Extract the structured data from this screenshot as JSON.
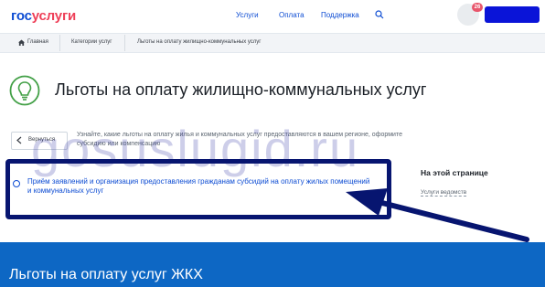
{
  "header": {
    "logo_gos": "гос",
    "logo_uslugi": "услуги",
    "nav": [
      "Услуги",
      "Оплата",
      "Поддержка"
    ],
    "search_icon": "search-icon",
    "notification_count": "26"
  },
  "breadcrumb": [
    "Главная",
    "Категории услуг",
    "Льготы на оплату жилищно-коммунальных услуг"
  ],
  "page": {
    "title": "Льготы на оплату жилищно-коммунальных услуг",
    "title_icon": "lightbulb-icon",
    "back_label": "Вернуться",
    "description": "Узнайте, какие льготы на оплату жилья и коммунальных услуг предоставляются в вашем регионе, оформите субсидию или компенсацию",
    "service_link": "Приём заявлений и организация предоставления гражданам субсидий на оплату жилых помещений и коммунальных услуг"
  },
  "aside": {
    "title": "На этой странице",
    "link": "Услуги ведомств"
  },
  "watermark": "gosuslugid.ru",
  "banner": {
    "title": "Льготы на оплату услуг ЖКХ"
  },
  "colors": {
    "brand_blue": "#0d4cd3",
    "brand_red": "#ee3f58",
    "banner_blue": "#0d67c4",
    "annotation_navy": "#071570"
  }
}
